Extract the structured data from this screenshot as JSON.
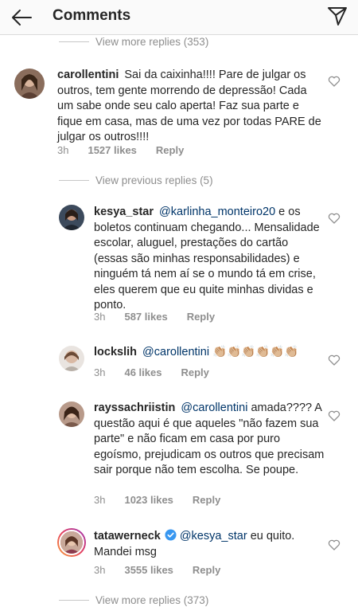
{
  "header": {
    "title": "Comments"
  },
  "top_view_more": {
    "label": "View more replies (353)"
  },
  "comments": [
    {
      "username": "carollentini",
      "text": "Sai da caixinha!!!! Pare de julgar os outros, tem gente morrendo de depressão! Cada um sabe onde seu calo aperta! Faz sua parte e fique em casa, mas de uma vez por todas PARE de julgar os outros!!!!",
      "time": "3h",
      "likes": "1527 likes",
      "reply": "Reply"
    }
  ],
  "previous_replies": {
    "label": "View previous replies (5)"
  },
  "replies": [
    {
      "username": "kesya_star",
      "mention": "@karlinha_monteiro20",
      "text": "e os boletos continuam chegando... Mensalidade escolar, aluguel, prestações do cartão (essas são minhas responsabilidades) e ninguém tá nem aí se o mundo tá em crise, eles querem que eu quite minhas dividas e ponto.",
      "time": "3h",
      "likes": "587 likes",
      "reply": "Reply"
    },
    {
      "username": "lockslih",
      "mention": "@carollentini",
      "text": "👏🏼👏🏼👏🏼👏🏼👏🏼👏🏼",
      "time": "3h",
      "likes": "46 likes",
      "reply": "Reply"
    },
    {
      "username": "rayssachriistin",
      "mention": "@carollentini",
      "text": "amada???? A questão aqui é que aqueles \"não fazem sua parte\"  e não ficam em casa por puro egoísmo, prejudicam os outros que precisam sair porque não tem escolha. Se poupe.",
      "time": "3h",
      "likes": "1023 likes",
      "reply": "Reply"
    },
    {
      "username": "tatawerneck",
      "mention": "@kesya_star",
      "text": "eu quito. Mandei msg",
      "time": "3h",
      "likes": "3555 likes",
      "reply": "Reply"
    }
  ],
  "bottom_view_more": {
    "label": "View more replies (373)"
  },
  "colors": {
    "text": "#262626",
    "secondary": "#8e8e8e",
    "mention": "#003569",
    "verified": "#3897f0"
  },
  "icons": [
    "back-arrow-icon",
    "send-icon",
    "heart-icon",
    "verified-badge-icon"
  ]
}
